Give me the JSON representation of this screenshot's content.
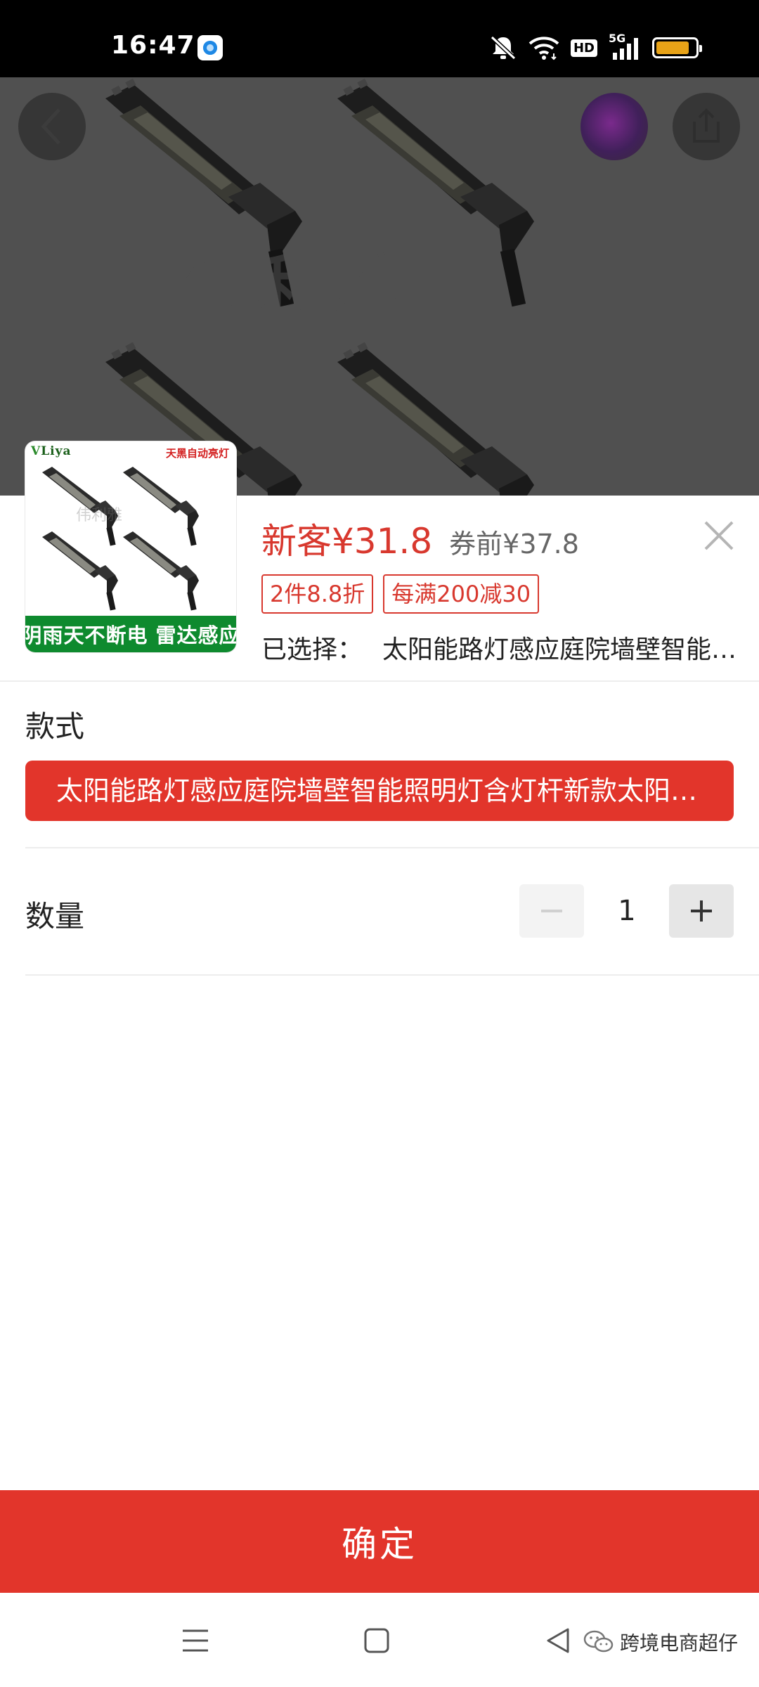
{
  "status_bar": {
    "time": "16:47",
    "hd_label": "HD",
    "network_label": "5G",
    "battery_level": 0.85,
    "icons": [
      "app-notification-icon",
      "mute-icon",
      "wifi-icon",
      "hd-icon",
      "signal-icon",
      "battery-icon"
    ]
  },
  "hero": {
    "watermark": "伟利雅",
    "icons": [
      "back-icon",
      "avatar-icon",
      "share-icon"
    ]
  },
  "product": {
    "thumbnail": {
      "brand": "Liya",
      "corner_tag": "天黑自动亮灯",
      "banner": "阴雨天不断电  雷达感应",
      "watermark": "伟利雅"
    },
    "price_now": "新客¥31.8",
    "price_original": "券前¥37.8",
    "tags": [
      "2件8.8折",
      "每满200减30"
    ],
    "selected_label": "已选择：",
    "selected_value": "太阳能路灯感应庭院墙壁智能照明灯含灯杆新款"
  },
  "style_section": {
    "label": "款式",
    "option": "太阳能路灯感应庭院墙壁智能照明灯含灯杆新款太阳能路灯"
  },
  "quantity_section": {
    "label": "数量",
    "value": "1"
  },
  "confirm_button": {
    "label": "确定"
  },
  "nav_bar": {
    "icons": [
      "menu-icon",
      "home-icon",
      "back-icon"
    ]
  },
  "credit": {
    "text": "跨境电商超仔"
  },
  "colors": {
    "accent": "#e2352b",
    "price": "#d8382e",
    "banner_green": "#0e8a2e"
  }
}
